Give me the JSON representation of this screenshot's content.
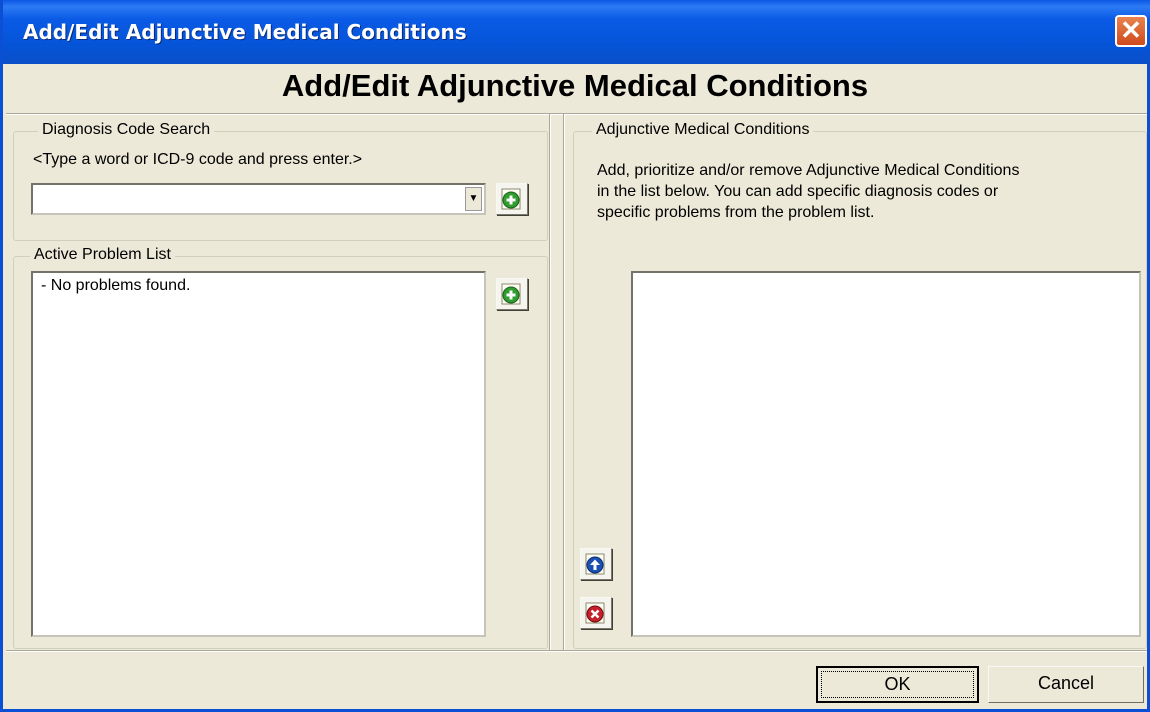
{
  "window": {
    "title": "Add/Edit Adjunctive Medical Conditions",
    "close_glyph": "✕"
  },
  "header": {
    "title": "Add/Edit Adjunctive Medical Conditions"
  },
  "diagnosis_search": {
    "group_label": "Diagnosis Code Search",
    "hint": "<Type a word or ICD-9 code and press enter.>",
    "value": "",
    "dropdown_glyph": "▼",
    "add_icon": "add-icon"
  },
  "problem_list": {
    "group_label": "Active Problem List",
    "items": [
      "- No problems found."
    ],
    "add_icon": "add-icon"
  },
  "adjunctive": {
    "group_label": "Adjunctive Medical Conditions",
    "description_lines": [
      "Add, prioritize and/or remove Adjunctive Medical Conditions",
      "in the list below.  You can add specific diagnosis codes or",
      "specific problems from the problem list."
    ],
    "items": [],
    "move_up_icon": "arrow-up-icon",
    "remove_icon": "remove-icon"
  },
  "buttons": {
    "ok_label": "OK",
    "cancel_label": "Cancel"
  },
  "colors": {
    "titlebar": "#0a5ae6",
    "dialog_bg": "#ece9d8",
    "add_green": "#2f9e2f",
    "up_blue": "#1a4fb4",
    "remove_red": "#c8202a"
  }
}
